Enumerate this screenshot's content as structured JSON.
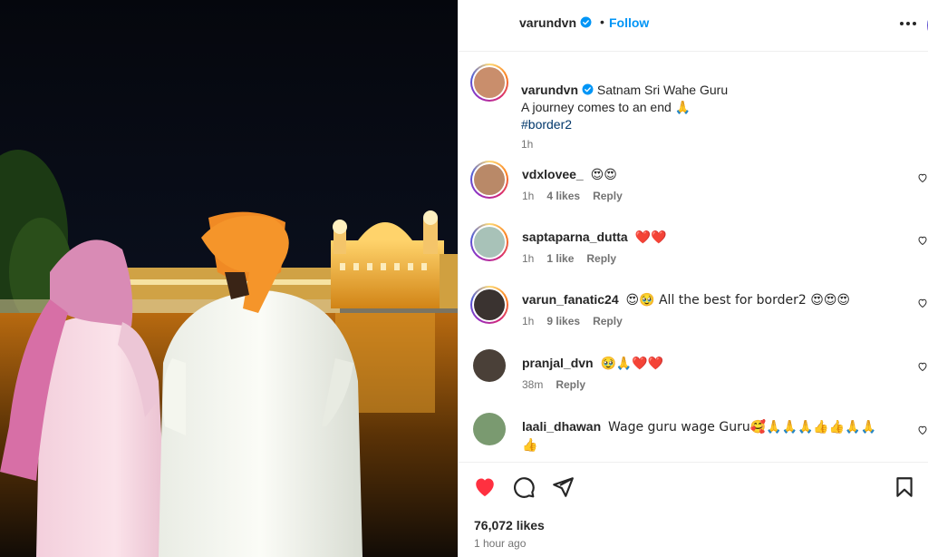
{
  "header": {
    "username": "varundvn",
    "separator": "•",
    "follow_label": "Follow"
  },
  "caption": {
    "username": "varundvn",
    "text_line1": "Satnam Sri Wahe Guru",
    "text_line2": "A journey comes to an end 🙏",
    "hashtag": "#border2",
    "time": "1h"
  },
  "comments": [
    {
      "username": "vdxlovee_",
      "text": "😍😍",
      "time": "1h",
      "likes": "4 likes",
      "reply": "Reply"
    },
    {
      "username": "saptaparna_dutta",
      "text": "❤️❤️",
      "time": "1h",
      "likes": "1 like",
      "reply": "Reply"
    },
    {
      "username": "varun_fanatic24",
      "text": "😍🥹 All the best for border2 😍😍😍",
      "time": "1h",
      "likes": "9 likes",
      "reply": "Reply"
    },
    {
      "username": "pranjal_dvn",
      "text": "🥹🙏❤️❤️",
      "time": "38m",
      "likes": "",
      "reply": "Reply"
    },
    {
      "username": "laali_dhawan",
      "text": "Wage guru wage Guru🥰🙏🙏🙏👍👍🙏🙏",
      "text2": "👍",
      "time": "",
      "likes": "",
      "reply": ""
    }
  ],
  "footer": {
    "likes": "76,072 likes",
    "time_ago": "1 hour ago"
  },
  "colors": {
    "accent": "#0095f6",
    "like_red": "#ff3040",
    "hashtag": "#00376b",
    "muted": "#737373"
  },
  "icons": [
    "verified-badge-icon",
    "more-options-icon",
    "heart-icon",
    "comment-icon",
    "share-icon",
    "save-icon"
  ]
}
